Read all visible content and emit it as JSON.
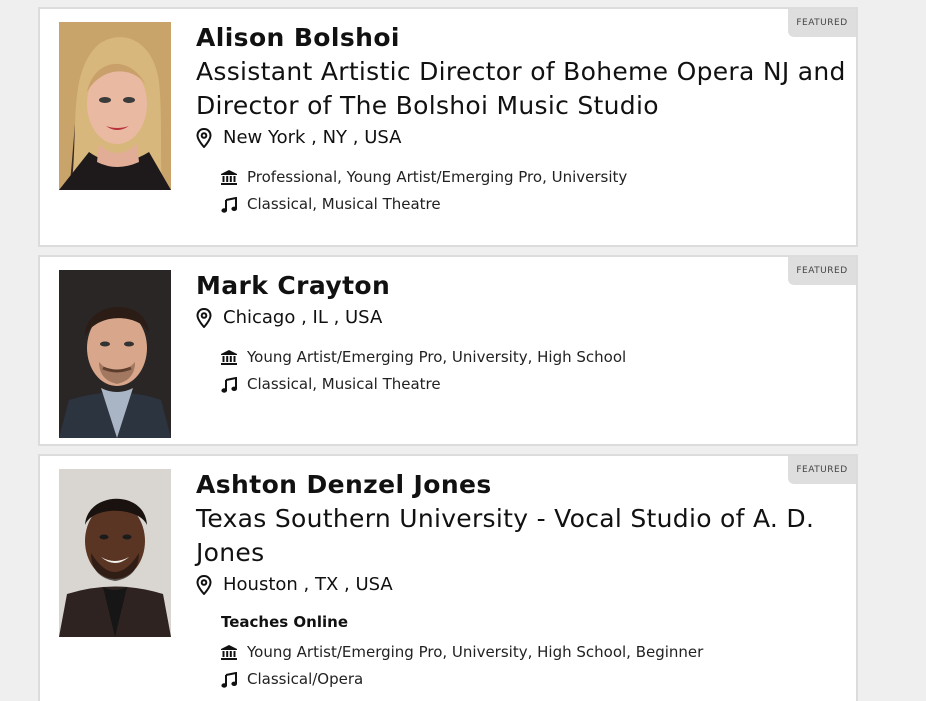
{
  "featured_label": "FEATURED",
  "teachers": [
    {
      "name": "Alison Bolshoi",
      "subtitle": "Assistant Artistic Director of Boheme Opera NJ and Director of The Bolshoi Music Studio",
      "location": "New York , NY , USA",
      "levels": "Professional, Young Artist/Emerging Pro, University",
      "genres": "Classical, Musical Theatre"
    },
    {
      "name": "Mark Crayton",
      "location": "Chicago , IL , USA",
      "levels": "Young Artist/Emerging Pro, University, High School",
      "genres": "Classical, Musical Theatre"
    },
    {
      "name": "Ashton Denzel Jones",
      "subtitle": "Texas Southern University - Vocal Studio of A. D. Jones",
      "location": "Houston , TX , USA",
      "online_label": "Teaches Online",
      "levels": "Young Artist/Emerging Pro, University, High School, Beginner",
      "genres": "Classical/Opera"
    }
  ],
  "icons": {
    "location": "map-pin-icon",
    "levels": "institution-icon",
    "genres": "music-note-icon"
  }
}
